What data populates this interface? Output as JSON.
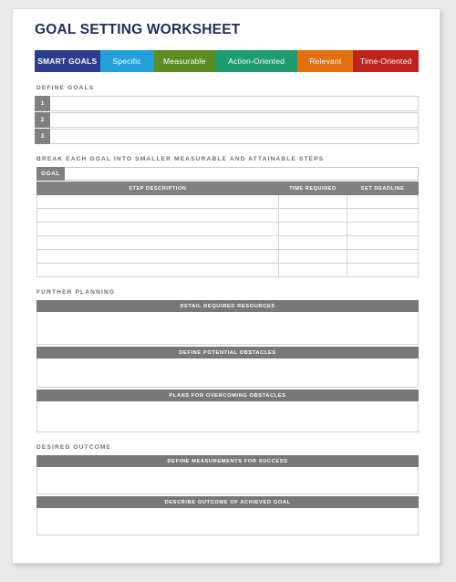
{
  "document": {
    "title": "GOAL SETTING WORKSHEET"
  },
  "smart_tabs": [
    {
      "label": "SMART GOALS",
      "color": "#2d3c8c",
      "width": 17.0,
      "strong": true
    },
    {
      "label": "Specific",
      "color": "#21a0dc",
      "width": 14.0,
      "strong": false
    },
    {
      "label": "Measurable",
      "color": "#5d8c21",
      "width": 16.0,
      "strong": false
    },
    {
      "label": "Action-Oriented",
      "color": "#1f9c72",
      "width": 21.5,
      "strong": false
    },
    {
      "label": "Relevant",
      "color": "#e2700c",
      "width": 14.5,
      "strong": false
    },
    {
      "label": "Time-Oriented",
      "color": "#bf231c",
      "width": 17.0,
      "strong": false
    }
  ],
  "sections": {
    "define_goals": {
      "label": "DEFINE GOALS",
      "rows": [
        {
          "number": "1",
          "value": ""
        },
        {
          "number": "2",
          "value": ""
        },
        {
          "number": "3",
          "value": ""
        }
      ]
    },
    "break_goals": {
      "label": "BREAK EACH GOAL INTO SMALLER MEASURABLE AND ATTAINABLE STEPS",
      "goal_tag": "GOAL",
      "goal_value": "",
      "columns": [
        "STEP DESCRIPTION",
        "TIME REQUIRED",
        "SET DEADLINE"
      ],
      "rows": [
        [
          "",
          "",
          ""
        ],
        [
          "",
          "",
          ""
        ],
        [
          "",
          "",
          ""
        ],
        [
          "",
          "",
          ""
        ],
        [
          "",
          "",
          ""
        ],
        [
          "",
          "",
          ""
        ]
      ]
    },
    "further_planning": {
      "label": "FURTHER PLANNING",
      "blocks": [
        {
          "banner": "DETAIL REQUIRED RESOURCES",
          "value": ""
        },
        {
          "banner": "DEFINE POTENTIAL OBSTACLES",
          "value": ""
        },
        {
          "banner": "PLANS FOR OVERCOMING OBSTACLES",
          "value": ""
        }
      ]
    },
    "desired_outcome": {
      "label": "DESIRED OUTCOME",
      "blocks": [
        {
          "banner": "DEFINE MEASUREMENTS FOR SUCCESS",
          "value": ""
        },
        {
          "banner": "DESCRIBE OUTCOME OF ACHIEVED GOAL",
          "value": ""
        }
      ]
    }
  }
}
